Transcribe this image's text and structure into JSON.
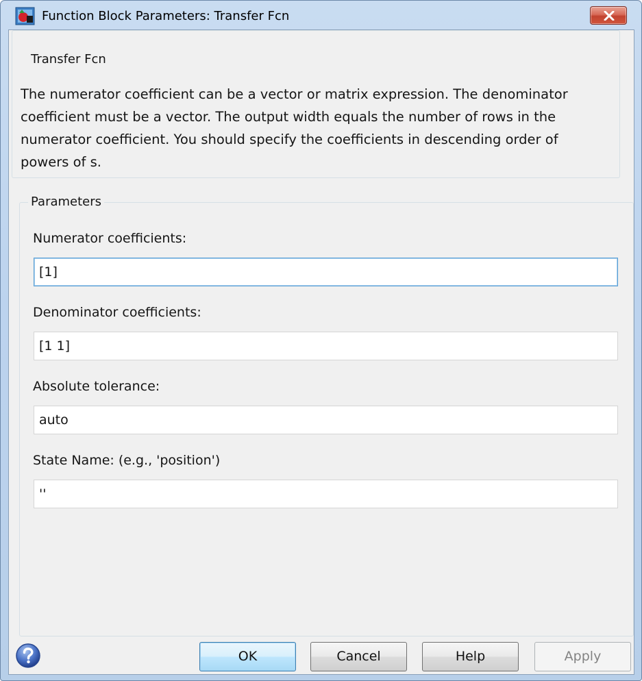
{
  "window": {
    "title": "Function Block Parameters: Transfer Fcn"
  },
  "description_group": {
    "title": "Transfer Fcn",
    "text": "The numerator coefficient can be a vector or matrix expression. The denominator coefficient must be a vector. The output width equals the number of rows in the numerator coefficient. You should specify the coefficients in descending order of powers of s."
  },
  "parameters_group": {
    "title": "Parameters",
    "fields": [
      {
        "label": "Numerator coefficients:",
        "value": "[1]"
      },
      {
        "label": "Denominator coefficients:",
        "value": "[1 1]"
      },
      {
        "label": "Absolute tolerance:",
        "value": "auto"
      },
      {
        "label": "State Name: (e.g., 'position')",
        "value": "''"
      }
    ]
  },
  "buttons": {
    "ok": "OK",
    "cancel": "Cancel",
    "help": "Help",
    "apply": "Apply"
  },
  "icons": {
    "app": "simulink-block-icon",
    "close": "close-icon",
    "help": "help-question-icon"
  },
  "colors": {
    "title_bar": "#c9dcf1",
    "close_button": "#c24330",
    "focus_border": "#5a9fd4",
    "default_button": "#bee6fd"
  }
}
